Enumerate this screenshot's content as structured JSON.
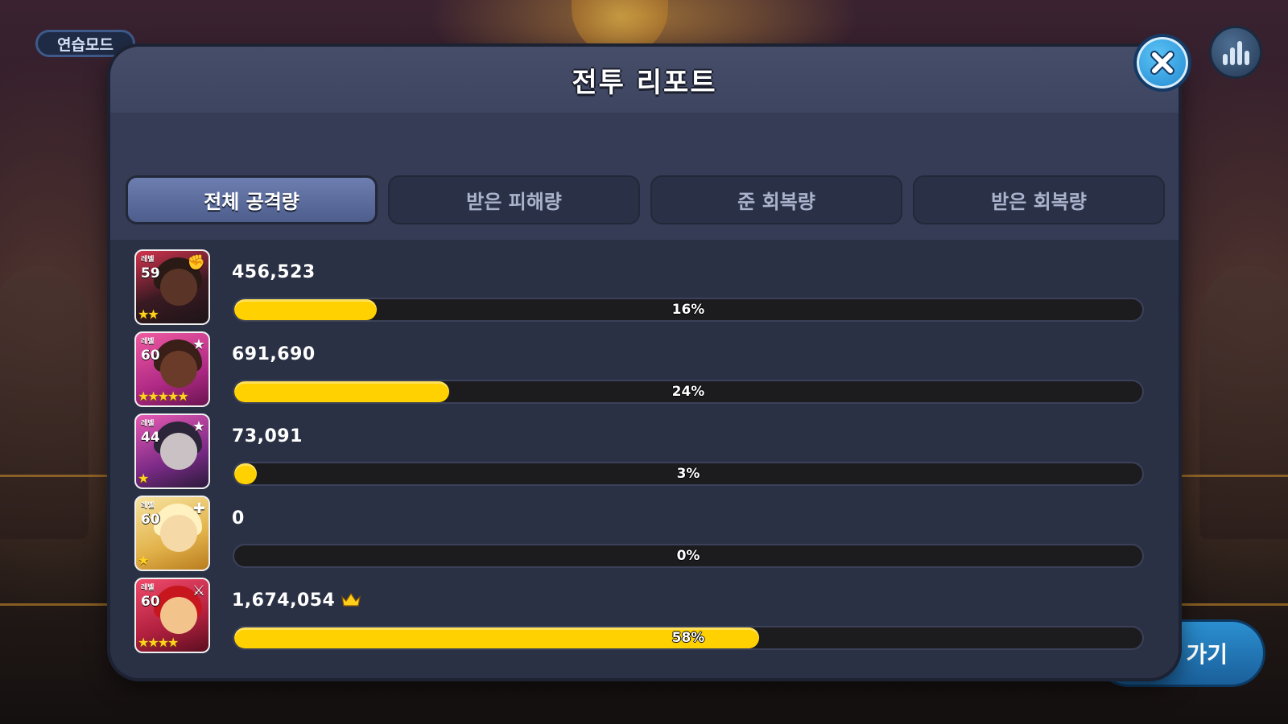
{
  "background": {
    "practice_mode_label": "연습모드",
    "bottom_button_label": "가기"
  },
  "dialog": {
    "title": "전투 리포트",
    "tabs": [
      {
        "label": "전체 공격량",
        "active": true
      },
      {
        "label": "받은 피해량",
        "active": false
      },
      {
        "label": "준 회복량",
        "active": false
      },
      {
        "label": "받은 회복량",
        "active": false
      }
    ]
  },
  "rows": [
    {
      "level_tag": "레벨",
      "level": "59",
      "value": "456,523",
      "percent_label": "16%",
      "fill": 0.156,
      "stars": "★★",
      "role_icon": "fist-icon",
      "top": false
    },
    {
      "level_tag": "레벨",
      "level": "60",
      "value": "691,690",
      "percent_label": "24%",
      "fill": 0.236,
      "stars": "★★★★★",
      "role_icon": "star-icon",
      "top": false
    },
    {
      "level_tag": "레벨",
      "level": "44",
      "value": "73,091",
      "percent_label": "3%",
      "fill": 0.025,
      "stars": "★",
      "role_icon": "star-icon",
      "top": false
    },
    {
      "level_tag": "레벨",
      "level": "60",
      "value": "0",
      "percent_label": "0%",
      "fill": 0,
      "stars": "★",
      "role_icon": "plus-icon",
      "top": false
    },
    {
      "level_tag": "레벨",
      "level": "60",
      "value": "1,674,054",
      "percent_label": "58%",
      "fill": 0.576,
      "stars": "★★★★",
      "role_icon": "sword-icon",
      "top": true
    }
  ],
  "colors": {
    "bar_fill": "#ffd100",
    "bar_track": "#1c1c1f",
    "panel": "#2b3145",
    "header": "#3e4560",
    "tab_active": "#5a6a9c",
    "close_button": "#2a9be0",
    "crown": "#ffcf1a"
  }
}
